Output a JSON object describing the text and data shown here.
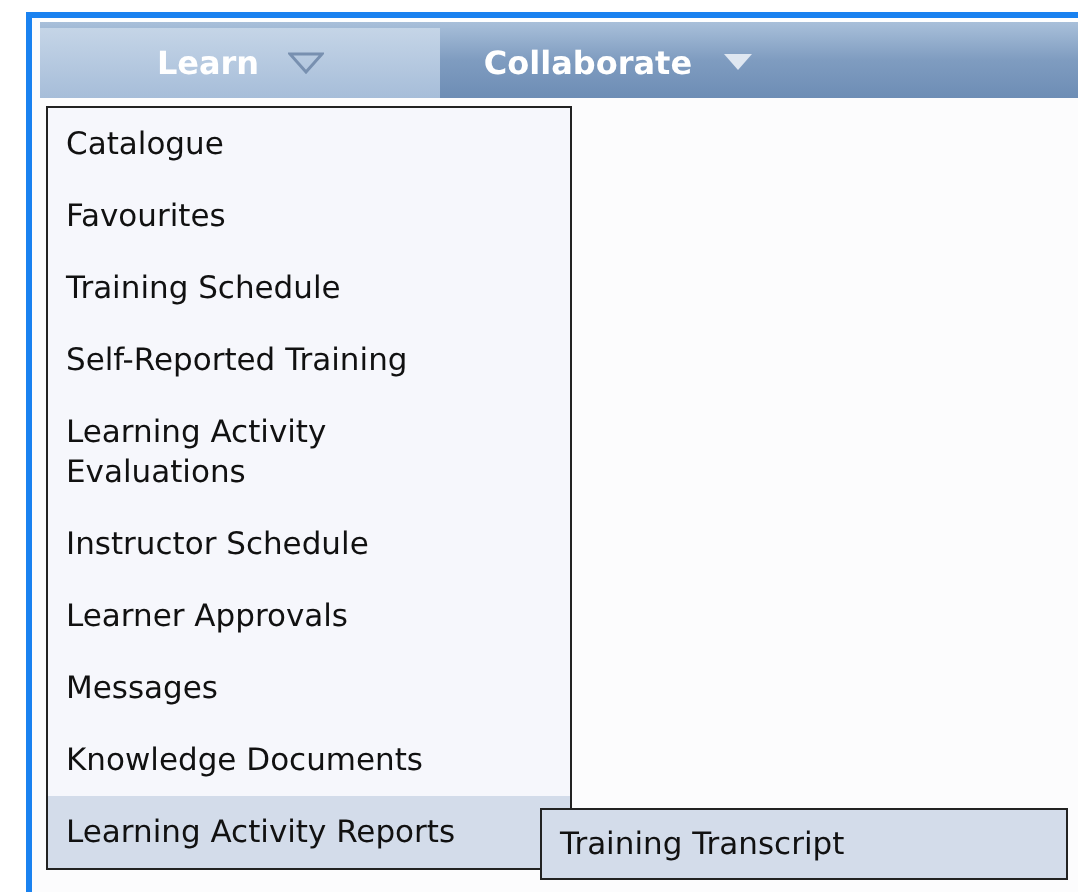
{
  "nav": [
    {
      "label": "Learn",
      "selected": true
    },
    {
      "label": "Collaborate",
      "selected": false
    }
  ],
  "menu": {
    "items": [
      {
        "label": "Catalogue",
        "selected": false
      },
      {
        "label": "Favourites",
        "selected": false
      },
      {
        "label": "Training Schedule",
        "selected": false
      },
      {
        "label": "Self-Reported Training",
        "selected": false
      },
      {
        "label": "Learning Activity Evaluations",
        "selected": false
      },
      {
        "label": "Instructor Schedule",
        "selected": false
      },
      {
        "label": "Learner Approvals",
        "selected": false
      },
      {
        "label": "Messages",
        "selected": false
      },
      {
        "label": "Knowledge Documents",
        "selected": false
      },
      {
        "label": "Learning Activity Reports",
        "selected": true
      }
    ]
  },
  "submenu": {
    "items": [
      {
        "label": "Training Transcript",
        "selected": true
      }
    ]
  }
}
